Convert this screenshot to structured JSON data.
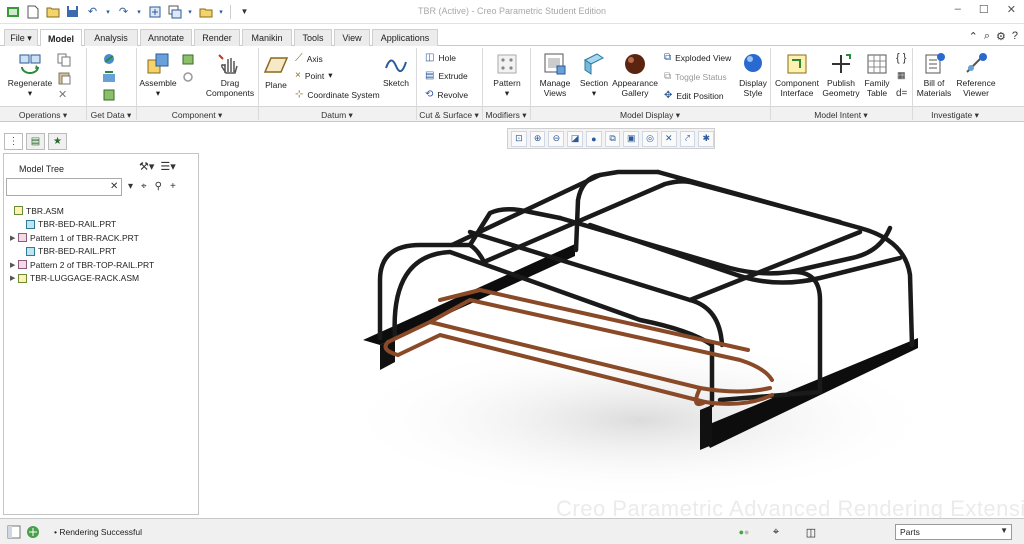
{
  "window": {
    "title": "TBR (Active) - Creo Parametric Student Edition"
  },
  "tabs": [
    {
      "label": "File ▾"
    },
    {
      "label": "Model"
    },
    {
      "label": "Analysis"
    },
    {
      "label": "Annotate"
    },
    {
      "label": "Render"
    },
    {
      "label": "Manikin"
    },
    {
      "label": "Tools"
    },
    {
      "label": "View"
    },
    {
      "label": "Applications"
    }
  ],
  "ribbon": {
    "regenerate": "Regenerate",
    "assemble": "Assemble",
    "drag_components": "Drag Components",
    "plane": "Plane",
    "axis": "Axis",
    "point": "Point",
    "coordinate_system": "Coordinate System",
    "sketch": "Sketch",
    "hole": "Hole",
    "extrude": "Extrude",
    "revolve": "Revolve",
    "pattern": "Pattern",
    "manage_views": "Manage Views",
    "section": "Section",
    "appearance_gallery": "Appearance Gallery",
    "exploded_view": "Exploded View",
    "toggle_status": "Toggle Status",
    "edit_position": "Edit Position",
    "display_style": "Display Style",
    "component_interface": "Component Interface",
    "publish_geometry": "Publish Geometry",
    "family_table": "Family Table",
    "bill_of_materials": "Bill of Materials",
    "reference_viewer": "Reference Viewer"
  },
  "groups": [
    {
      "label": "Operations ▾"
    },
    {
      "label": "Get Data ▾"
    },
    {
      "label": "Component ▾"
    },
    {
      "label": "Datum ▾"
    },
    {
      "label": "Cut & Surface ▾"
    },
    {
      "label": "Modifiers ▾"
    },
    {
      "label": "Model Display ▾"
    },
    {
      "label": "Model Intent ▾"
    },
    {
      "label": "Investigate ▾"
    }
  ],
  "model_tree": {
    "title": "Model Tree",
    "search_value": "",
    "nodes": [
      {
        "label": "TBR.ASM"
      },
      {
        "label": "TBR-BED-RAIL.PRT"
      },
      {
        "label": "Pattern 1 of TBR-RACK.PRT"
      },
      {
        "label": "TBR-BED-RAIL.PRT"
      },
      {
        "label": "Pattern 2 of TBR-TOP-RAIL.PRT"
      },
      {
        "label": "TBR-LUGGAGE-RACK.ASM"
      }
    ]
  },
  "canvas": {
    "watermark": "Creo Parametric Advanced Rendering Extension"
  },
  "status": {
    "message": "Rendering Successful",
    "filter_value": "Parts"
  },
  "colors": {
    "accent": "#2a5a9a",
    "rail": "#1a1a1a",
    "rack": "#8a4a28",
    "bed": "#0d0d0d"
  }
}
